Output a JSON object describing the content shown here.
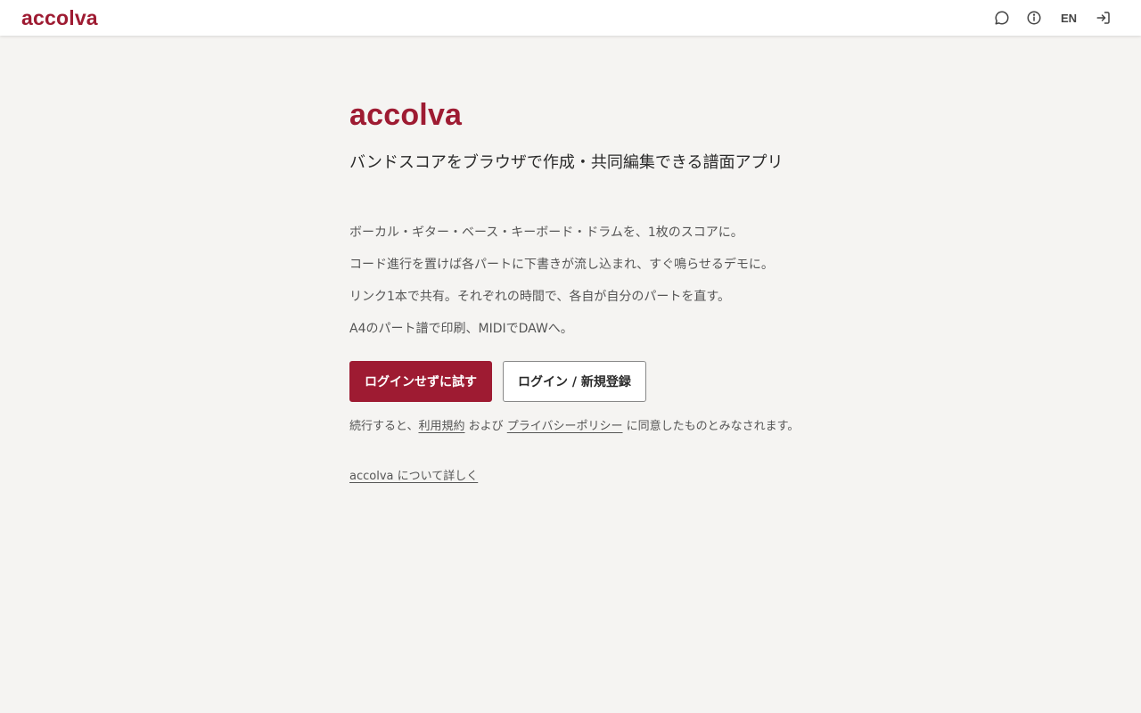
{
  "header": {
    "brand": "accolva",
    "lang_label": "EN",
    "icons": [
      "chat-icon",
      "info-icon",
      "login-icon"
    ]
  },
  "hero": {
    "brand": "accolva",
    "tagline": "バンドスコアをブラウザで作成・共同編集できる譜面アプリ"
  },
  "features": [
    "ボーカル・ギター・ベース・キーボード・ドラムを、1枚のスコアに。",
    "コード進行を置けば各パートに下書きが流し込まれ、すぐ鳴らせるデモに。",
    "リンク1本で共有。それぞれの時間で、各自が自分のパートを直す。",
    "A4のパート譜で印刷、MIDIでDAWへ。"
  ],
  "actions": {
    "try_label": "ログインせずに試す",
    "login_label": "ログイン / 新規登録"
  },
  "terms": {
    "prefix": "続行すると、",
    "terms_link": "利用規約",
    "middle": " および ",
    "privacy_link": "プライバシーポリシー",
    "suffix": " に同意したものとみなされます。"
  },
  "about": {
    "link": "accolva について詳しく"
  },
  "colors": {
    "accent": "#9e1b32",
    "background": "#f5f4f2"
  }
}
